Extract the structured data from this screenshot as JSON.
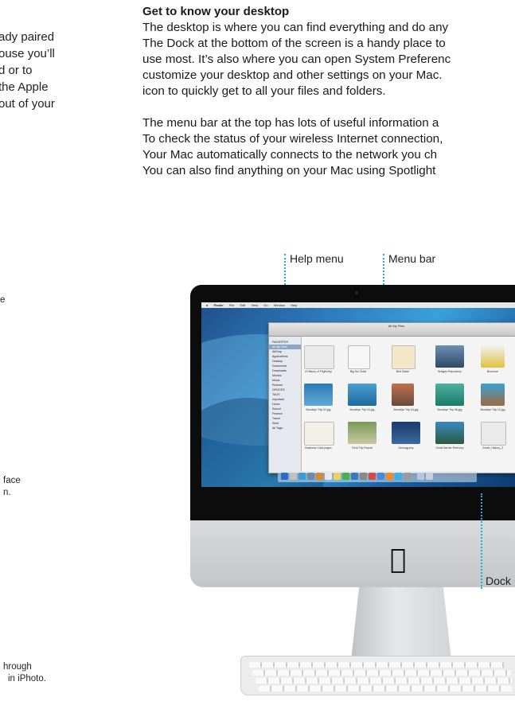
{
  "left_column": {
    "intro_lines": [
      "ady paired",
      "ouse you’ll",
      "d or to",
      "the Apple",
      "out of your"
    ],
    "fragment_e": "e",
    "facetime_lines": [
      "face",
      "n."
    ],
    "iphoto_lines": [
      "hrough",
      "in iPhoto."
    ]
  },
  "desktop_section": {
    "heading": "Get to know your desktop",
    "paragraph1": [
      "The desktop is where you can find everything and do any",
      "The Dock at the bottom of the screen is a handy place to",
      "use most. It’s also where you can open System Preferenc",
      "customize your desktop and other settings on your Mac.",
      "icon to quickly get to all your files and folders."
    ],
    "paragraph2": [
      "The menu bar at the top has lots of useful information a",
      "To check the status of your wireless Internet connection,",
      "Your Mac automatically connects to the network you ch",
      "You can also find anything on your Mac using Spotlight"
    ]
  },
  "callouts": {
    "help_menu": "Help menu",
    "menu_bar": "Menu bar",
    "dock": "Dock"
  },
  "colors": {
    "callout_line": "#29a8e0",
    "text": "#1a1a1a"
  },
  "screen": {
    "menubar_items": [
      "Finder",
      "File",
      "Edit",
      "View",
      "Go",
      "Window",
      "Help"
    ],
    "finder_title": "All My Files",
    "sidebar_items": [
      "FAVORITES",
      "All My Files",
      "AirDrop",
      "Applications",
      "Desktop",
      "Documents",
      "Downloads",
      "Movies",
      "Music",
      "Pictures",
      "DEVICES",
      "TAGS",
      "Important",
      "Home",
      "School",
      "Finance",
      "Travel",
      "Work",
      "All Tags..."
    ],
    "file_labels": [
      "A History of Flight.key",
      "Big Sur Solar",
      "Bird Safari",
      "Bridges Repository",
      "Brochure",
      "Brooklyn Trip 02.jpg",
      "Brooklyn Trip 03.jpg",
      "Brooklyn Trip 04.jpg",
      "Brooklyn Trip 08.jpg",
      "Brooklyn Trip 10.jpg",
      "Business Card.pages",
      "Field Trip Report",
      "Geology.key",
      "Great Barrier Reef.key",
      "Greek_History_2"
    ]
  }
}
